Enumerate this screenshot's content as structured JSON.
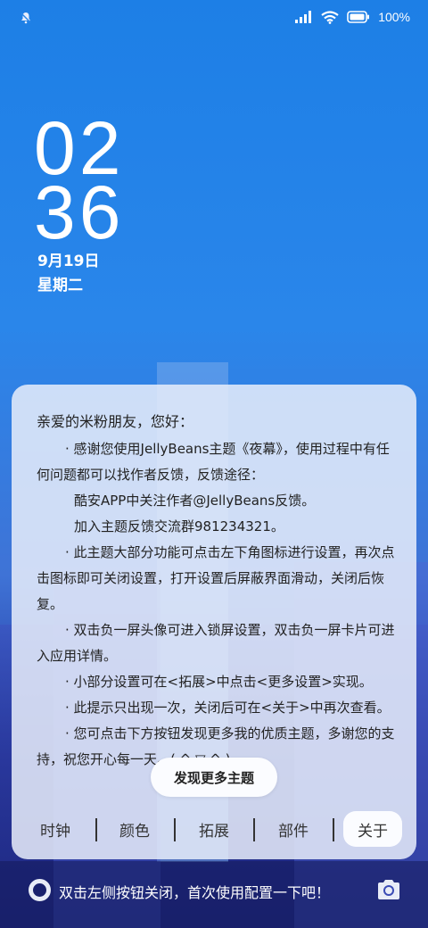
{
  "status": {
    "battery_text": "100%"
  },
  "clock": {
    "hour": "02",
    "minute": "36",
    "date": "9月19日",
    "weekday": "星期二"
  },
  "panel": {
    "greeting": "亲爱的米粉朋友，您好：",
    "paragraphs": [
      "· 感谢您使用JellyBeans主题《夜幕》，使用过程中有任何问题都可以找作者反馈，反馈途径：",
      "酷安APP中关注作者@JellyBeans反馈。",
      "加入主题反馈交流群981234321。",
      "· 此主题大部分功能可点击左下角图标进行设置，再次点击图标即可关闭设置，打开设置后屏蔽界面滑动，关闭后恢复。",
      "· 双击负一屏头像可进入锁屏设置，双击负一屏卡片可进入应用详情。",
      "· 小部分设置可在<拓展>中点击<更多设置>实现。",
      "· 此提示只出现一次，关闭后可在<关于>中再次查看。",
      "· 您可点击下方按钮发现更多我的优质主题，多谢您的支持，祝您开心每一天。( ^ ▽ ^ )"
    ],
    "discover_button": "发现更多主题",
    "tabs": [
      "时钟",
      "颜色",
      "拓展",
      "部件",
      "关于"
    ]
  },
  "hint": {
    "text": "双击左侧按钮关闭，首次使用配置一下吧！"
  }
}
